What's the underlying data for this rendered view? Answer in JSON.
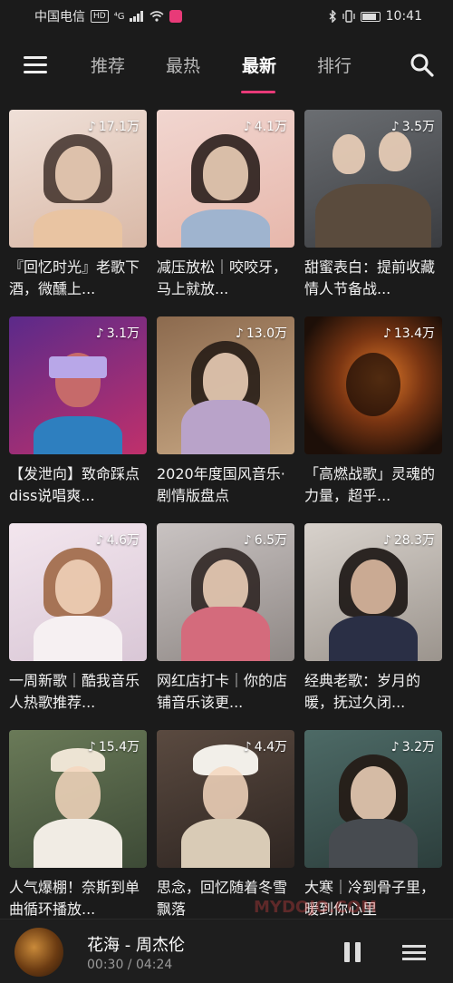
{
  "status_bar": {
    "carrier": "中国电信",
    "hd": "HD",
    "network": "⁴G",
    "time": "10:41"
  },
  "nav": {
    "tabs": [
      "推荐",
      "最热",
      "最新",
      "排行"
    ],
    "active_tab": "最新"
  },
  "playlists": [
    {
      "plays": "17.1万",
      "title": "『回忆时光』老歌下酒，微醺上..."
    },
    {
      "plays": "4.1万",
      "title": "减压放松｜咬咬牙，马上就放..."
    },
    {
      "plays": "3.5万",
      "title": "甜蜜表白：提前收藏情人节备战..."
    },
    {
      "plays": "3.1万",
      "title": "【发泄向】致命踩点diss说唱爽..."
    },
    {
      "plays": "13.0万",
      "title": "2020年度国风音乐·剧情版盘点"
    },
    {
      "plays": "13.4万",
      "title": "「高燃战歌」灵魂的力量，超乎..."
    },
    {
      "plays": "4.6万",
      "title": "一周新歌｜酷我音乐人热歌推荐..."
    },
    {
      "plays": "6.5万",
      "title": "网红店打卡｜你的店铺音乐该更..."
    },
    {
      "plays": "28.3万",
      "title": "经典老歌：岁月的暖，抚过久闭..."
    },
    {
      "plays": "15.4万",
      "title": "人气爆棚！奈斯到单曲循环播放..."
    },
    {
      "plays": "4.4万",
      "title": "思念，回忆随着冬雪飘落"
    },
    {
      "plays": "3.2万",
      "title": "大寒｜冷到骨子里，暖到你心里"
    }
  ],
  "player": {
    "track": "花海 - 周杰伦",
    "time": "00:30 / 04:24"
  },
  "watermark": "MYDOJO.COM",
  "colors": {
    "accent": "#e83a78",
    "background": "#1b1b1b"
  }
}
